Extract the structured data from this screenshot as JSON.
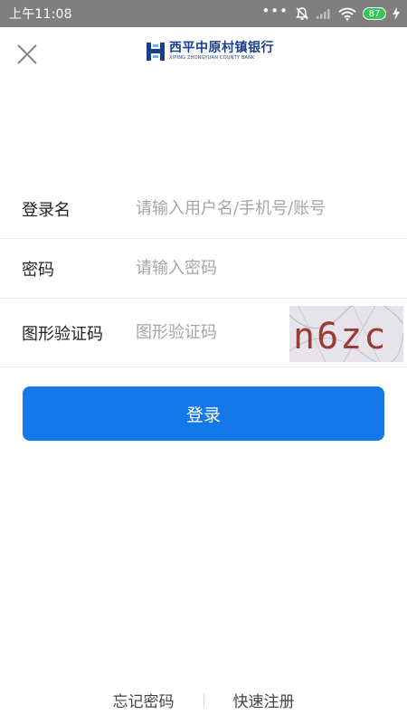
{
  "status_bar": {
    "time": "上午11:08",
    "battery_level": "87",
    "icons": [
      "more-dots-icon",
      "bell-muted-icon",
      "signal-icon",
      "wifi-icon",
      "battery-icon",
      "charging-icon"
    ]
  },
  "header": {
    "close_icon": "close-icon",
    "logo": {
      "name_cn": "西平中原村镇银行",
      "name_en": "XIPING ZHONGYUAN COUNTY BANK",
      "color": "#1a3e8c"
    }
  },
  "form": {
    "username": {
      "label": "登录名",
      "placeholder": "请输入用户名/手机号/账号",
      "value": ""
    },
    "password": {
      "label": "密码",
      "placeholder": "请输入密码",
      "value": ""
    },
    "captcha": {
      "label": "图形验证码",
      "placeholder": "图形验证码",
      "value": "",
      "image_text": "n6zc"
    }
  },
  "login_button": {
    "label": "登录",
    "color": "#1478e8"
  },
  "footer": {
    "forgot_password": "忘记密码",
    "quick_register": "快速注册"
  }
}
